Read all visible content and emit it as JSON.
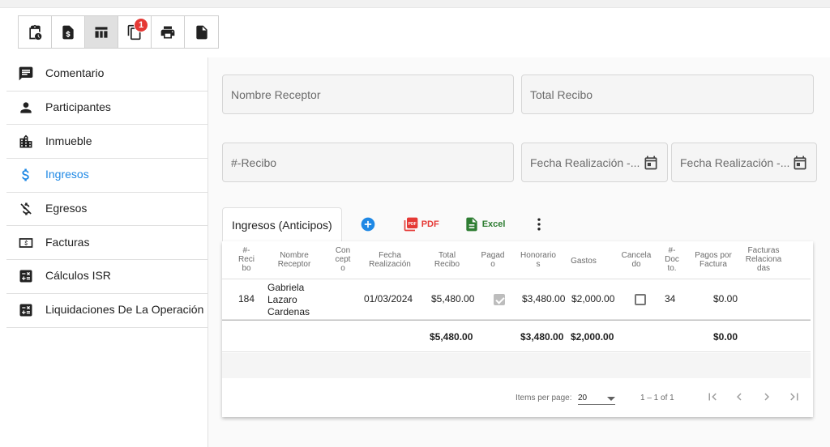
{
  "toolbar": {
    "buttons": [
      {
        "icon": "clipboard-clock-icon"
      },
      {
        "icon": "invoice-dollar-icon"
      },
      {
        "icon": "table-icon"
      },
      {
        "icon": "copy-icon",
        "badge": "1"
      },
      {
        "icon": "print-icon"
      },
      {
        "icon": "document-icon"
      }
    ]
  },
  "sidebar": {
    "items": [
      {
        "label": "Comentario",
        "icon": "comment-icon"
      },
      {
        "label": "Participantes",
        "icon": "person-icon"
      },
      {
        "label": "Inmueble",
        "icon": "building-icon"
      },
      {
        "label": "Ingresos",
        "icon": "dollar-icon",
        "active": true
      },
      {
        "label": "Egresos",
        "icon": "money-off-icon"
      },
      {
        "label": "Facturas",
        "icon": "bill-icon"
      },
      {
        "label": "Cálculos ISR",
        "icon": "calculator-icon"
      },
      {
        "label": "Liquidaciones De La Operación",
        "icon": "calculator-icon"
      }
    ]
  },
  "filters": {
    "nombre_receptor": "Nombre Receptor",
    "total_recibo": "Total Recibo",
    "recibo": "#-Recibo",
    "fecha_realizacion_1": "Fecha Realización -...",
    "fecha_realizacion_2": "Fecha Realización -..."
  },
  "tabs": {
    "ingresos": "Ingresos (Anticipos)",
    "pdf": "PDF",
    "excel": "Excel"
  },
  "table": {
    "headers": {
      "recibo": [
        "#-",
        "Reci",
        "bo"
      ],
      "nombre": [
        "Nombre",
        "Receptor"
      ],
      "concepto": [
        "Con",
        "cept",
        "o"
      ],
      "fecha": [
        "Fecha",
        "Realización"
      ],
      "total": [
        "Total",
        "Recibo"
      ],
      "pagado": [
        "Pagad",
        "o"
      ],
      "honorarios": [
        "Honorario",
        "s"
      ],
      "gastos": [
        "Gastos"
      ],
      "cancelado": [
        "Cancela",
        "do"
      ],
      "docto": [
        "#-",
        "Doc",
        "to."
      ],
      "pagos": [
        "Pagos por",
        "Factura"
      ],
      "facturas": [
        "Facturas",
        "Relaciona",
        "das"
      ]
    },
    "rows": [
      {
        "recibo": "184",
        "nombre": [
          "Gabriela",
          "Lazaro",
          "Cardenas"
        ],
        "fecha": "01/03/2024",
        "total": "$5,480.00",
        "pagado": true,
        "honorarios": "$3,480.00",
        "gastos": "$2,000.00",
        "cancelado": false,
        "docto": "34",
        "pagos": "$0.00"
      }
    ],
    "totals": {
      "total": "$5,480.00",
      "honorarios": "$3,480.00",
      "gastos": "$2,000.00",
      "pagos": "$0.00"
    }
  },
  "pager": {
    "items_per_page_label": "Items per page:",
    "page_size": "20",
    "range": "1 – 1 of 1"
  },
  "colors": {
    "accent": "#1e88e5",
    "pdf": "#e53935",
    "excel": "#2e7d32",
    "badge": "#e53935"
  }
}
